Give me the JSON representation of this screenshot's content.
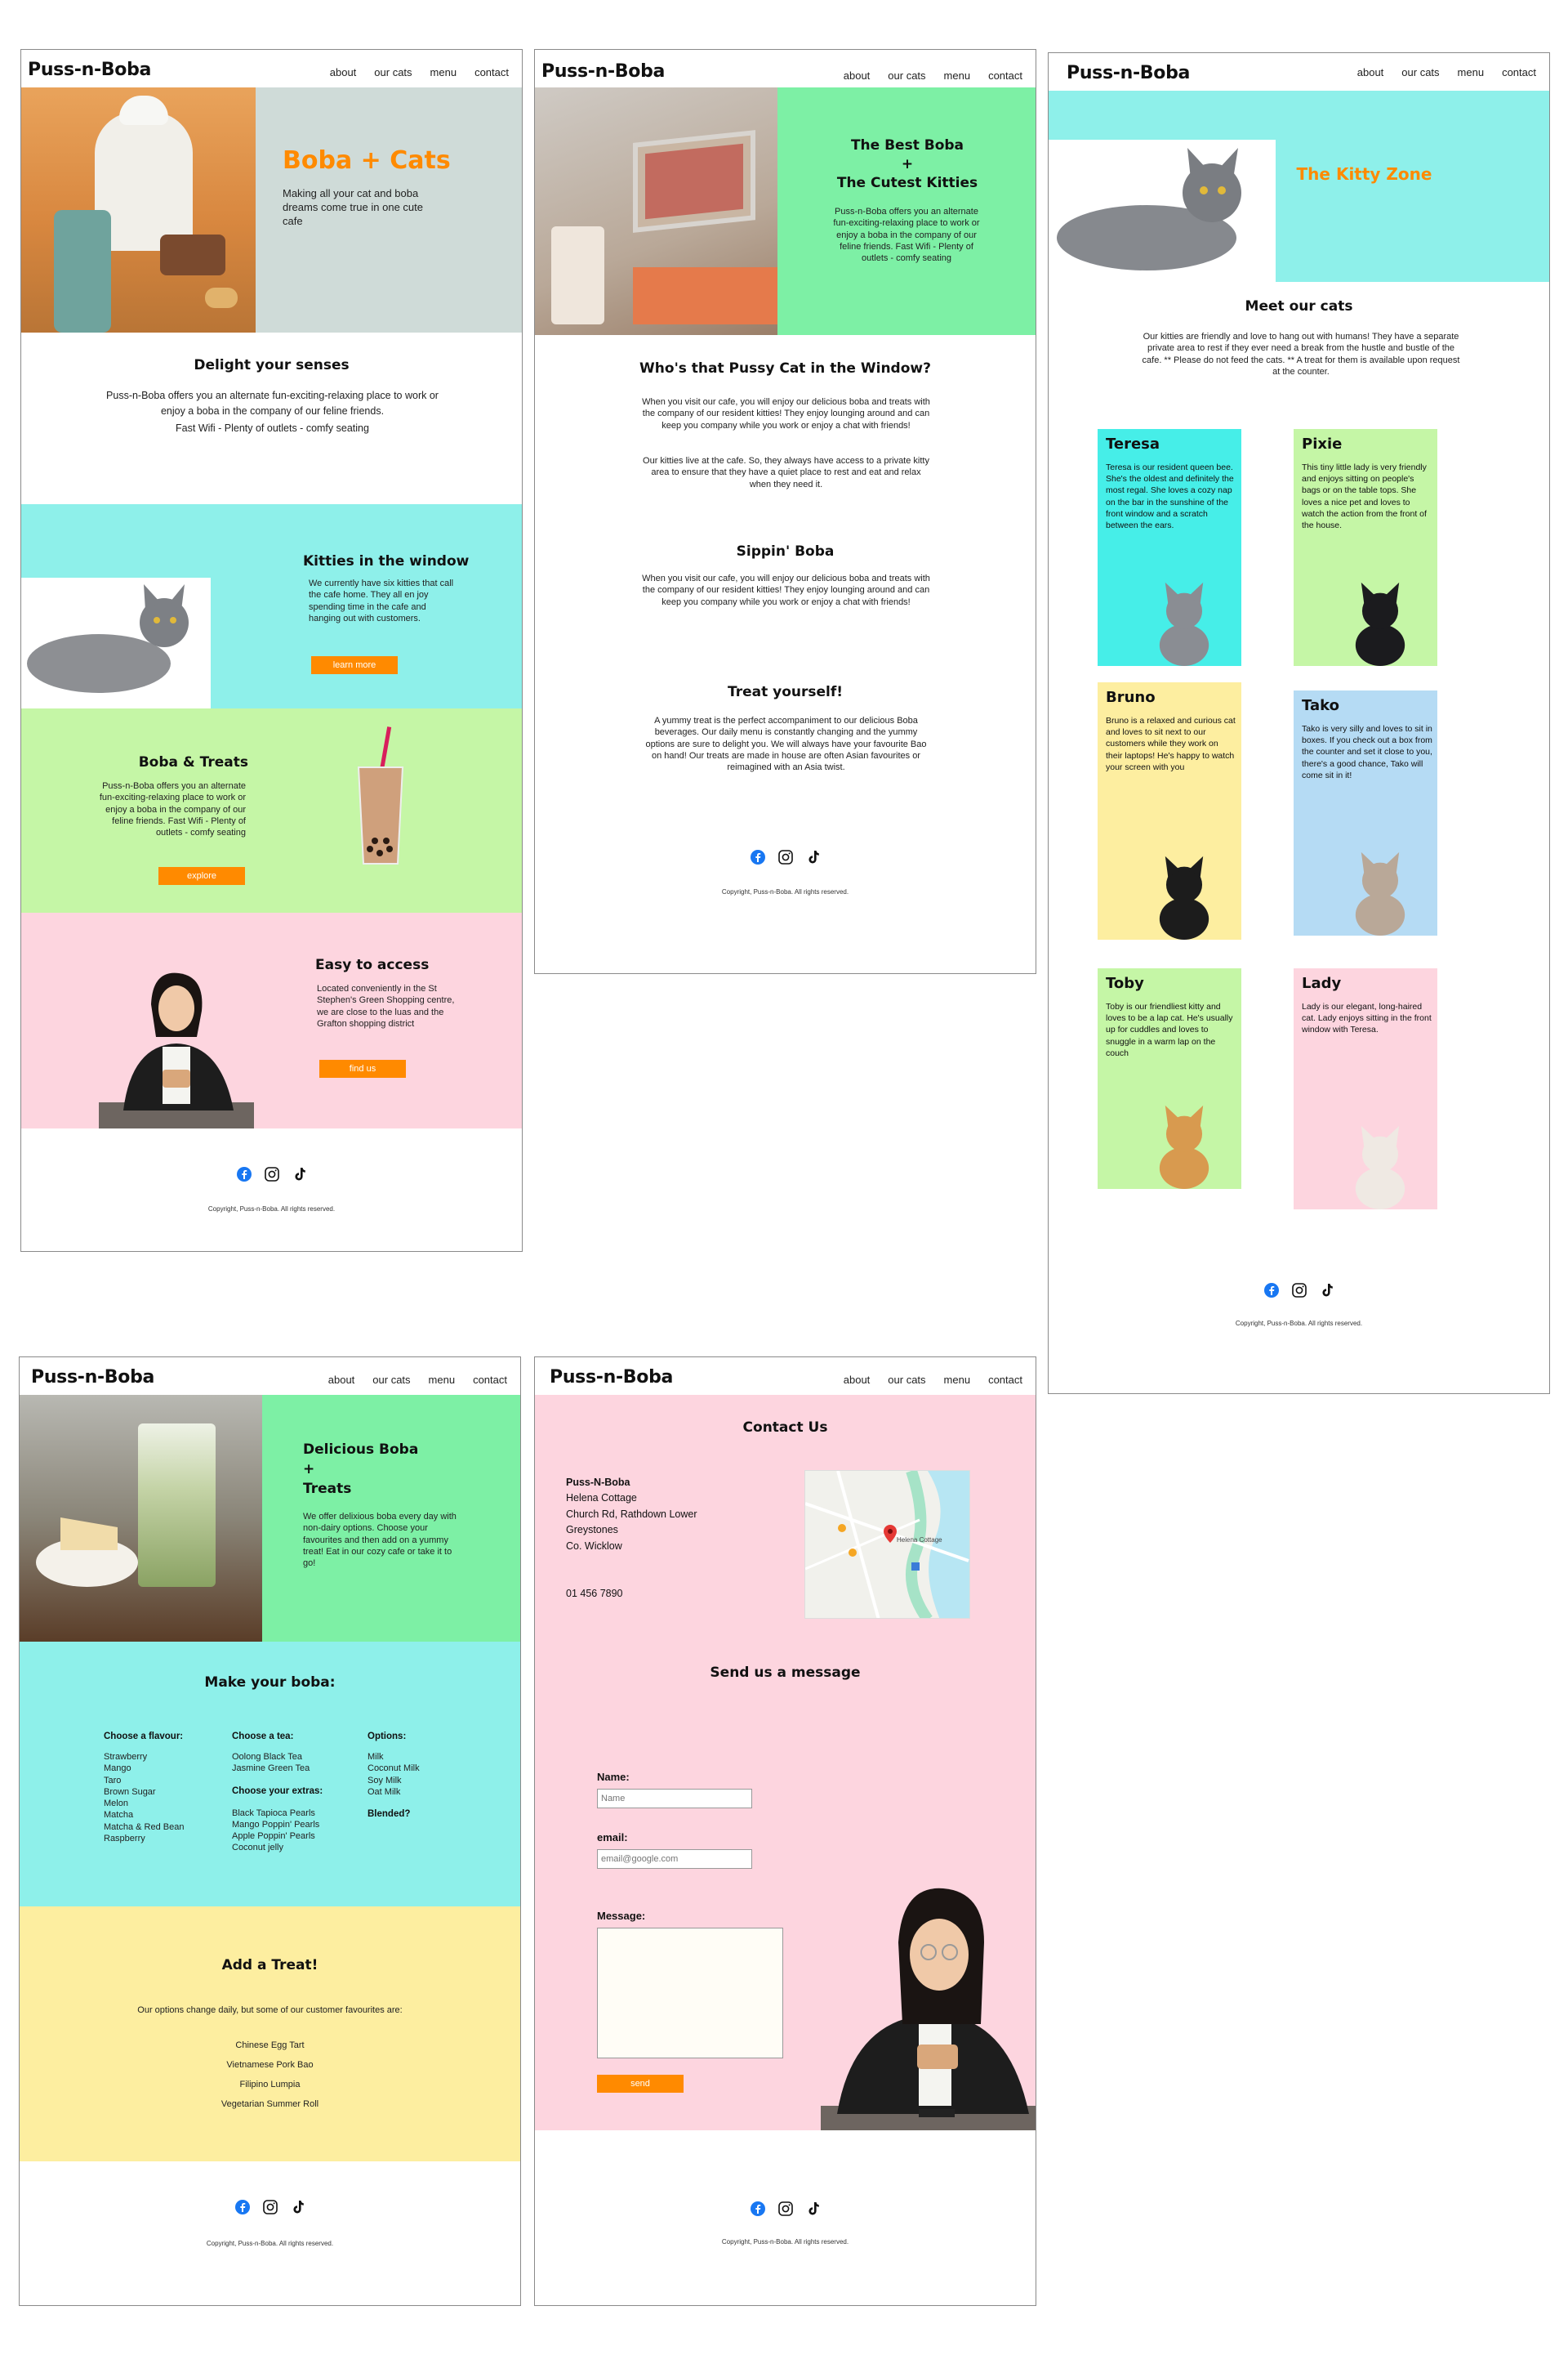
{
  "nav": {
    "brand": "Puss-n-Boba",
    "about": "about",
    "cats": "our cats",
    "menu": "menu",
    "contact": "contact"
  },
  "footer": {
    "copyright": "Copyright, Puss-n-Boba. All rights reserved."
  },
  "home": {
    "hero_title": "Boba + Cats",
    "hero_sub": "Making all your cat and boba dreams come true in one cute cafe",
    "delight_title": "Delight your senses",
    "delight_text": "Puss-n-Boba offers you an alternate fun-exciting-relaxing place to work or enjoy a boba in the company of our feline friends.",
    "delight_text2": "Fast Wifi - Plenty of outlets - comfy seating",
    "window_title": "Kitties in the window",
    "window_text": "We currently have six kitties that call the cafe home. They all en joy spending time in the cafe and hanging out with customers.",
    "window_btn": "learn more",
    "treats_title": "Boba & Treats",
    "treats_text": "Puss-n-Boba offers you an alternate fun-exciting-relaxing place to work or enjoy a boba in the company of our feline friends. Fast Wifi - Plenty of outlets - comfy seating",
    "treats_btn": "explore",
    "access_title": "Easy to access",
    "access_text": "Located conveniently in the St Stephen's Green Shopping centre, we are close to the luas and the Grafton shopping district",
    "access_btn": "find us"
  },
  "about": {
    "hero_l1": "The Best Boba",
    "hero_l2": "+",
    "hero_l3": "The Cutest Kitties",
    "hero_text": "Puss-n-Boba offers you an alternate fun-exciting-relaxing place to work or enjoy a boba in the company of our feline friends. Fast Wifi - Plenty of outlets - comfy seating",
    "window_title": "Who's that Pussy Cat in the Window?",
    "window_p1": "When you visit our cafe, you will enjoy our delicious boba and treats with the company of our resident kitties! They enjoy lounging around and can keep you company while you work or enjoy a chat with friends!",
    "window_p2": "Our kitties live at the cafe. So, they always have access to a private kitty area to ensure that they have a quiet place to rest and eat and relax when they need it.",
    "sip_title": "Sippin' Boba",
    "sip_text": "When you visit our cafe, you will enjoy our delicious boba and treats with the company of our resident kitties! They enjoy lounging around and can keep you company while you work or enjoy a chat with friends!",
    "treat_title": "Treat yourself!",
    "treat_text": "A yummy treat is the perfect accompaniment to our delicious Boba beverages. Our daily menu is constantly changing and the yummy options are sure to delight you. We will always have your favourite Bao on hand! Our treats are made in house are often Asian favourites or reimagined with an Asia twist."
  },
  "cats": {
    "hero_title": "The Kitty Zone",
    "meet_title": "Meet our cats",
    "meet_text": "Our kitties are friendly and love to hang out with humans! They have a separate private area to rest if they ever need a break from the hustle and bustle of the cafe. ** Please do not feed the cats. ** A treat for them is available upon request at the counter.",
    "list": [
      {
        "name": "Teresa",
        "desc": "Teresa is our resident queen bee. She's the oldest and definitely the most regal. She loves a cozy nap on the bar in the sunshine of the front window and a scratch between the ears.",
        "color": "#46eee8"
      },
      {
        "name": "Pixie",
        "desc": "This tiny little lady is very friendly and enjoys sitting on people's bags or on the table tops. She loves a nice pet and loves to watch the action from the front of the house.",
        "color": "#c5f6a6"
      },
      {
        "name": "Bruno",
        "desc": "Bruno is a relaxed and curious cat and loves to sit next to our customers while they work on their laptops! He's happy to watch your screen with you",
        "color": "#fdeea0"
      },
      {
        "name": "Tako",
        "desc": "Tako is very silly and loves to sit in boxes. If you check out a box from the counter and set it close to you, there's a good chance, Tako will come sit in it!",
        "color": "#b5dbf4"
      },
      {
        "name": "Toby",
        "desc": "Toby is our friendliest kitty and loves to be a lap cat. He's usually up for cuddles and loves to snuggle in a warm lap on the couch",
        "color": "#c5f6a6"
      },
      {
        "name": "Lady",
        "desc": "Lady is our elegant, long-haired cat. Lady enjoys sitting in the front window with Teresa.",
        "color": "#fdd5df"
      }
    ]
  },
  "menu": {
    "hero_l1": "Delicious Boba",
    "hero_l2": "+",
    "hero_l3": "Treats",
    "hero_text": "We offer delixious boba every day with non-dairy options. Choose your favourites and then add on a yummy treat! Eat in our cozy cafe or take it to go!",
    "make_title": "Make your boba:",
    "flavour_h": "Choose a flavour:",
    "flavours": [
      "Strawberry",
      "Mango",
      "Taro",
      "Brown Sugar",
      "Melon",
      "Matcha",
      "Matcha & Red Bean",
      "Raspberry"
    ],
    "tea_h": "Choose a tea:",
    "teas": [
      "Oolong Black Tea",
      "Jasmine Green Tea"
    ],
    "extras_h": "Choose your extras:",
    "extras": [
      "Black Tapioca Pearls",
      "Mango Poppin' Pearls",
      "Apple Poppin' Pearls",
      "Coconut jelly"
    ],
    "options_h": "Options:",
    "options": [
      "Milk",
      "Coconut Milk",
      "Soy Milk",
      "Oat Milk"
    ],
    "blended_h": "Blended?",
    "treat_title": "Add a Treat!",
    "treat_intro": "Our options change daily, but some of our customer favourites are:",
    "treats": [
      "Chinese Egg Tart",
      "Vietnamese Pork Bao",
      "Filipino Lumpia",
      "Vegetarian Summer Roll"
    ]
  },
  "contact": {
    "title": "Contact Us",
    "addr": [
      "Puss-N-Boba",
      "Helena Cottage",
      "Church Rd, Rathdown Lower",
      "Greystones",
      "Co. Wicklow"
    ],
    "phone": "01 456 7890",
    "map_label": "Helena Cottage",
    "msg_title": "Send us a message",
    "name_label": "Name:",
    "name_ph": "Name",
    "email_label": "email:",
    "email_ph": "email@google.com",
    "message_label": "Message:",
    "send": "send"
  },
  "colors": {
    "accent": "#ff8a00",
    "teal": "#8ef0ea",
    "lime": "#c5f6a6",
    "pink": "#fdd5df",
    "mint": "#7df0a5",
    "yellow": "#fdeea0"
  },
  "icons": [
    "facebook-icon",
    "instagram-icon",
    "tiktok-icon"
  ]
}
